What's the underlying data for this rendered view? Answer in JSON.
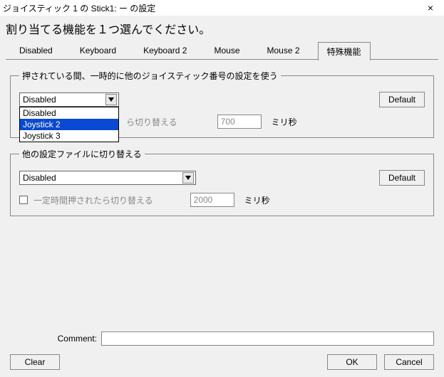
{
  "window": {
    "title": "ジョイスティック 1 の Stick1: ー の設定",
    "close_glyph": "×"
  },
  "heading": "割り当てる機能を１つ選んでください。",
  "tabs": {
    "items": [
      {
        "label": "Disabled"
      },
      {
        "label": "Keyboard"
      },
      {
        "label": "Keyboard 2"
      },
      {
        "label": "Mouse"
      },
      {
        "label": "Mouse 2"
      },
      {
        "label": "特殊機能"
      }
    ],
    "active_index": 5
  },
  "group_joystick": {
    "legend": "押されている間、一時的に他のジョイスティック番号の設定を使う",
    "combo_value": "Disabled",
    "combo_options": [
      "Disabled",
      "Joystick 2",
      "Joystick 3"
    ],
    "combo_selected_index": 1,
    "default_label": "Default",
    "check_label_fragment": "ら切り替える",
    "time_value": "700",
    "time_unit": "ミリ秒"
  },
  "group_profile": {
    "legend": "他の設定ファイルに切り替える",
    "combo_value": "Disabled",
    "default_label": "Default",
    "check_label": "一定時間押されたら切り替える",
    "time_value": "2000",
    "time_unit": "ミリ秒"
  },
  "comment": {
    "label": "Comment:",
    "value": ""
  },
  "buttons": {
    "clear": "Clear",
    "ok": "OK",
    "cancel": "Cancel"
  }
}
